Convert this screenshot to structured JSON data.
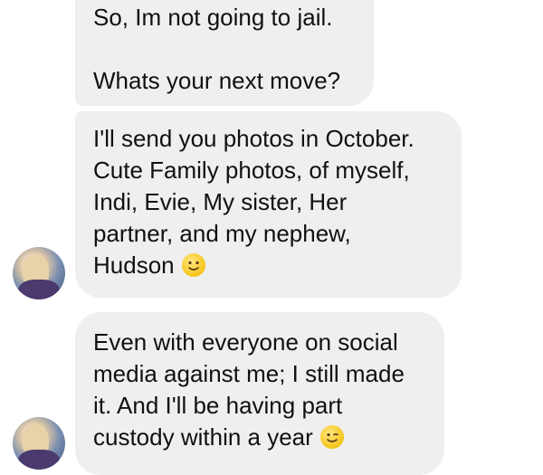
{
  "messages": [
    {
      "id": "msg1",
      "lines_a": [
        "So, Im not going to jail."
      ],
      "lines_b": [
        "Whats your next move?"
      ]
    },
    {
      "id": "msg2",
      "lines": [
        "I'll send you photos in October.",
        "Cute Family photos, of myself,",
        "Indi, Evie, My sister, Her",
        "partner, and my nephew,",
        "Hudson"
      ],
      "emoji": "slightly-smiling-face-icon"
    },
    {
      "id": "msg3",
      "lines": [
        "Even with everyone on social",
        "media against me; I still made",
        "it. And I'll be having part",
        "custody within a year"
      ],
      "emoji": "winking-face-icon"
    }
  ],
  "colors": {
    "bubble_background": "#efefef",
    "text": "#111111",
    "page_background": "#ffffff",
    "emoji_fill": "#f5c518"
  }
}
